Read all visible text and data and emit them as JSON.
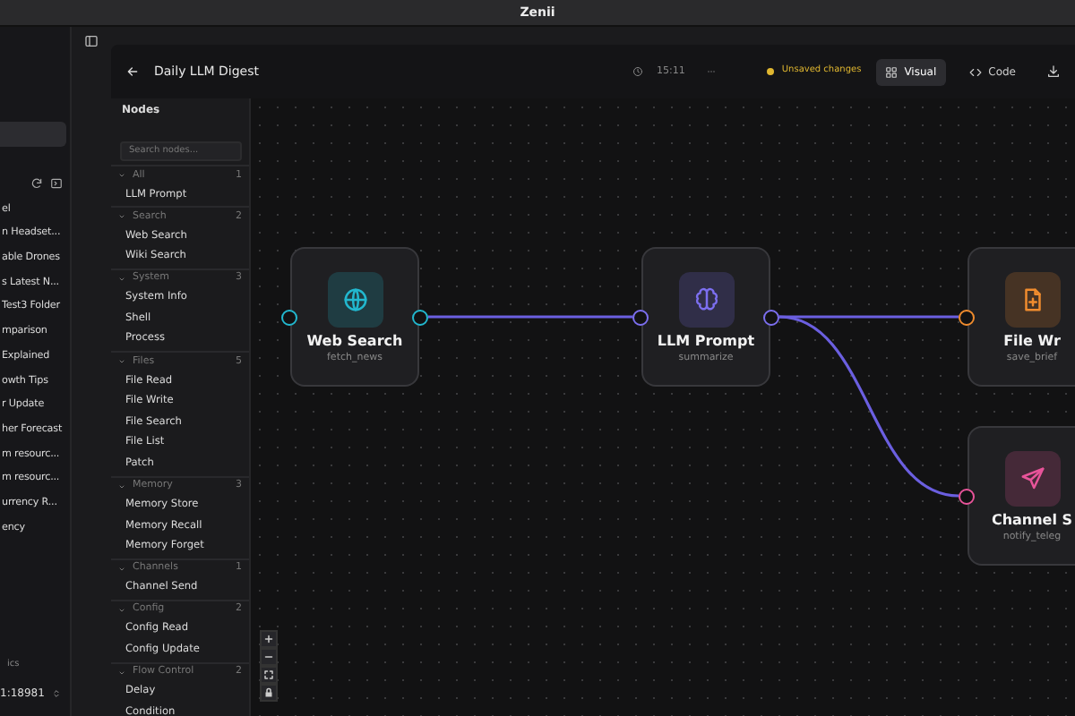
{
  "window": {
    "title": "Zenii"
  },
  "sidebar": {
    "items": [
      {
        "selected": true
      },
      {
        "label": "el",
        "selected": false
      },
      {
        "label": "n Headset...",
        "selected": false
      },
      {
        "label": "able Drones",
        "selected": false
      },
      {
        "label": "s Latest N...",
        "selected": false
      },
      {
        "label": "Test3 Folder",
        "selected": false
      },
      {
        "label": "mparison",
        "selected": false
      },
      {
        "label": "Explained",
        "selected": false
      },
      {
        "label": "owth Tips",
        "selected": false
      },
      {
        "label": "r Update",
        "selected": false
      },
      {
        "label": "her Forecast",
        "selected": false
      },
      {
        "label": "m resourc...",
        "selected": false
      },
      {
        "label": "m resourc...",
        "selected": false
      },
      {
        "label": "urrency R...",
        "selected": false
      },
      {
        "label": "ency",
        "selected": false
      }
    ],
    "footer_label": "ics",
    "server": "1:18981"
  },
  "header": {
    "title": "Daily LLM Digest",
    "time": "15:11",
    "status": "Unsaved changes",
    "tabs": [
      {
        "label": "Visual",
        "kind": "visual",
        "selected": true
      },
      {
        "label": "Code",
        "kind": "code",
        "selected": false
      }
    ]
  },
  "palette": {
    "title": "Nodes",
    "search": {
      "placeholder": "Search nodes..."
    },
    "groups": [
      {
        "label": "All",
        "count": "1",
        "expanded": true,
        "items": [
          "LLM Prompt"
        ]
      },
      {
        "label": "Search",
        "count": "2",
        "expanded": true,
        "items": [
          "Web Search",
          "Wiki Search"
        ]
      },
      {
        "label": "System",
        "count": "3",
        "expanded": true,
        "items": [
          "System Info",
          "Shell",
          "Process"
        ]
      },
      {
        "label": "Files",
        "count": "5",
        "expanded": true,
        "items": [
          "File Read",
          "File Write",
          "File Search",
          "File List",
          "Patch"
        ]
      },
      {
        "label": "Memory",
        "count": "3",
        "expanded": true,
        "items": [
          "Memory Store",
          "Memory Recall",
          "Memory Forget"
        ]
      },
      {
        "label": "Channels",
        "count": "1",
        "expanded": true,
        "items": [
          "Channel Send"
        ]
      },
      {
        "label": "Config",
        "count": "2",
        "expanded": true,
        "items": [
          "Config Read",
          "Config Update"
        ]
      },
      {
        "label": "Flow Control",
        "count": "2",
        "expanded": true,
        "items": [
          "Delay",
          "Condition"
        ]
      }
    ]
  },
  "canvas": {
    "nodes": [
      {
        "title": "Web Search",
        "subtitle": "fetch_news",
        "kind": "search",
        "color": "#22b8cf"
      },
      {
        "title": "LLM Prompt",
        "subtitle": "summarize",
        "kind": "llm",
        "color": "#7c6ff0"
      },
      {
        "title": "File Wr",
        "subtitle": "save_brief",
        "kind": "file",
        "color": "#f08c2e"
      },
      {
        "title": "Channel S",
        "subtitle": "notify_teleg",
        "kind": "channel",
        "color": "#e8549a"
      }
    ]
  }
}
